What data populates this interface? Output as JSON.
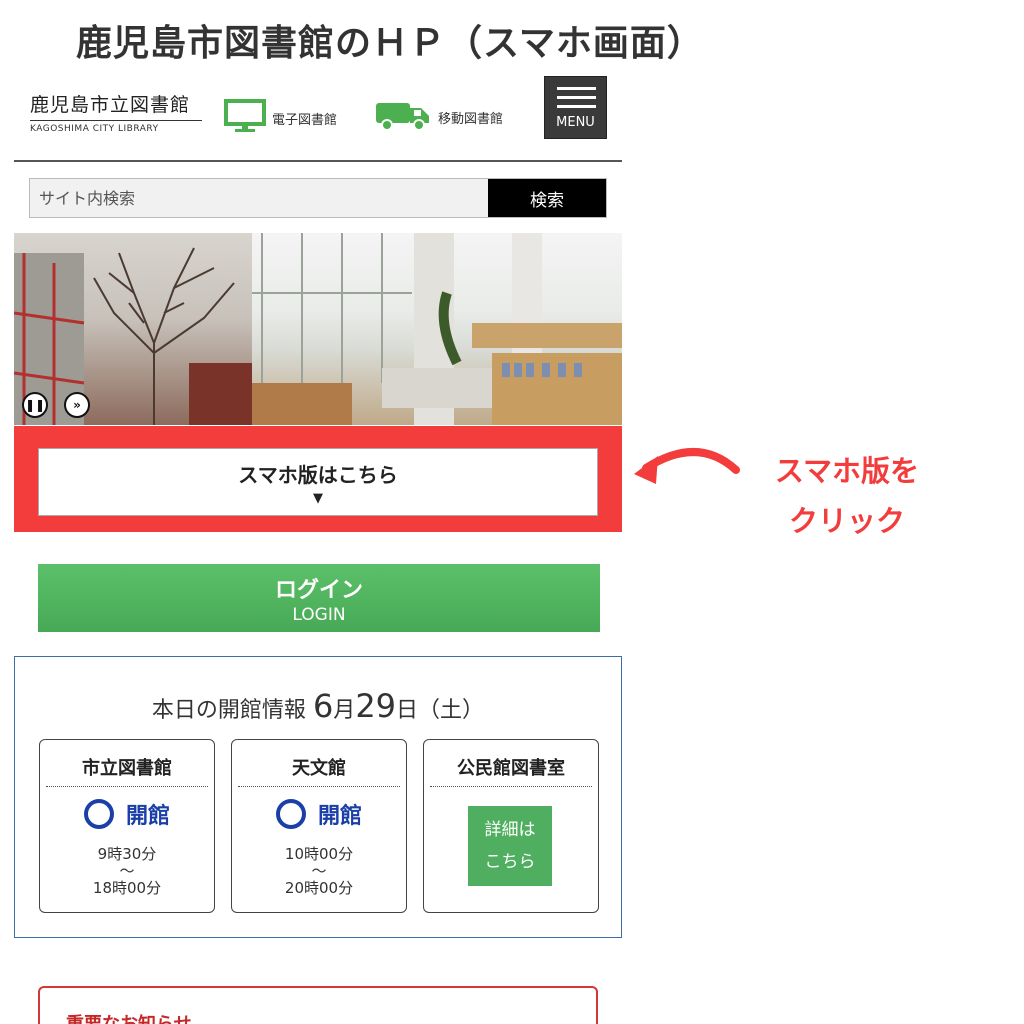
{
  "page": {
    "title": "鹿児島市図書館のＨＰ（スマホ画面）"
  },
  "header": {
    "logo_main": "鹿児島市立図書館",
    "logo_sub": "KAGOSHIMA CITY LIBRARY",
    "ebook_label": "電子図書館",
    "ebook_icon": "monitor-icon",
    "mobile_label": "移動図書館",
    "mobile_icon": "truck-icon",
    "menu_label": "MENU",
    "accent": "#4caf50"
  },
  "search": {
    "placeholder": "サイト内検索",
    "button_label": "検索"
  },
  "hero": {
    "pause_icon": "pause-icon",
    "next_icon": "next-icon"
  },
  "smartphone": {
    "label": "スマホ版はこちら",
    "arrow": "▼",
    "highlight_color": "#f33c3c"
  },
  "login": {
    "label_ja": "ログイン",
    "label_en": "LOGIN"
  },
  "opening": {
    "heading_prefix": "本日の開館情報",
    "month": "6",
    "month_unit": "月",
    "day": "29",
    "day_unit": "日",
    "weekday": "（土）",
    "facilities": [
      {
        "name": "市立図書館",
        "status": "開館",
        "open": "9時30分",
        "tilde": "〜",
        "close": "18時00分"
      },
      {
        "name": "天文館",
        "status": "開館",
        "open": "10時00分",
        "tilde": "〜",
        "close": "20時00分"
      },
      {
        "name": "公民館図書室",
        "detail_line1": "詳細は",
        "detail_line2": "こちら"
      }
    ],
    "status_color": "#1a3fa8"
  },
  "notice": {
    "title": "重要なお知らせ"
  },
  "annotation": {
    "line1": "スマホ版を",
    "line2": "クリック",
    "color": "#f33c3c"
  }
}
